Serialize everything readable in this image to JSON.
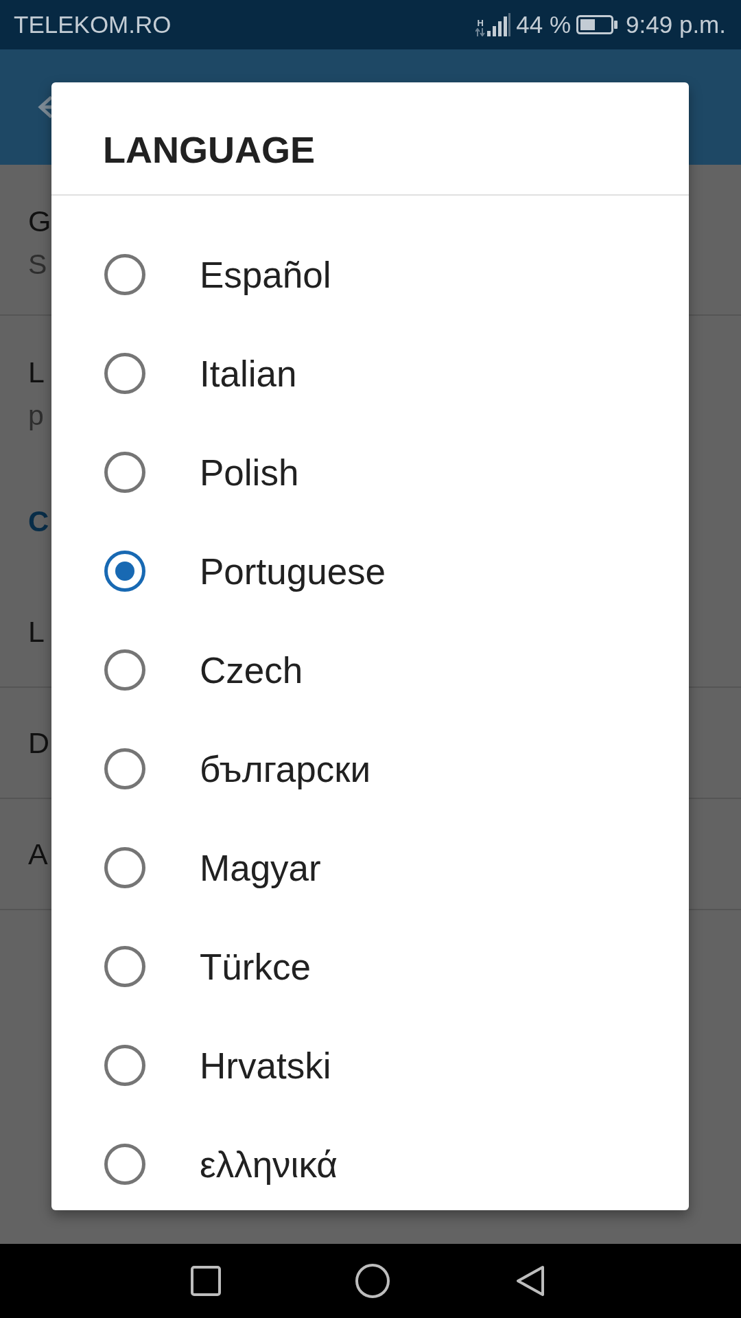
{
  "status_bar": {
    "carrier": "TELEKOM.RO",
    "network": "H",
    "battery": "44 %",
    "time": "9:49 p.m."
  },
  "settings": [
    {
      "kind": "two_line",
      "title": "G",
      "subtitle": "S"
    },
    {
      "kind": "two_line",
      "title": "L",
      "subtitle": "p"
    },
    {
      "kind": "header",
      "title": "C"
    },
    {
      "kind": "one_line",
      "title": "L"
    },
    {
      "kind": "one_line",
      "title": "D"
    },
    {
      "kind": "one_line",
      "title": "A"
    }
  ],
  "dialog": {
    "title": "LANGUAGE",
    "options": [
      {
        "label": "Español",
        "selected": false
      },
      {
        "label": "Italian",
        "selected": false
      },
      {
        "label": "Polish",
        "selected": false
      },
      {
        "label": "Portuguese",
        "selected": true
      },
      {
        "label": "Czech",
        "selected": false
      },
      {
        "label": "български",
        "selected": false
      },
      {
        "label": "Magyar",
        "selected": false
      },
      {
        "label": "Türkce",
        "selected": false
      },
      {
        "label": "Hrvatski",
        "selected": false
      },
      {
        "label": "ελληνικά",
        "selected": false
      }
    ]
  }
}
